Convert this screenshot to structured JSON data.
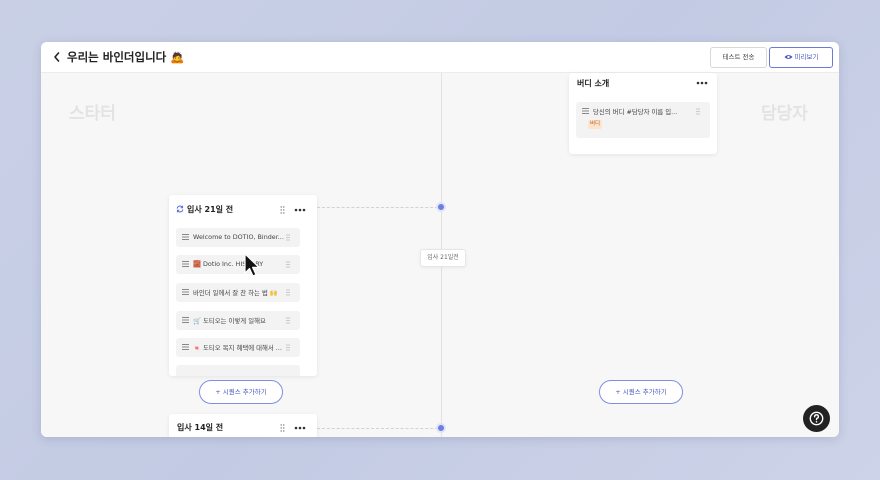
{
  "header": {
    "back_icon": "chevron-left-icon",
    "title": "우리는 바인더입니다 🙇",
    "test_send_label": "테스트 전송",
    "preview_label": "미리보기",
    "preview_icon": "eye-icon"
  },
  "lanes": {
    "left_label": "스타터",
    "right_label": "담당자"
  },
  "timeline": {
    "tooltip": "입사 21일전"
  },
  "cards": {
    "buddy": {
      "title": "버디 소개",
      "items": [
        {
          "label": "당신의 버디 #담당자 이름 입...",
          "tag": "버디"
        }
      ]
    },
    "day21": {
      "title": "입사 21일 전",
      "items": [
        {
          "label": "Welcome to DOTIO, Binder..."
        },
        {
          "label": "🧱 Dotio Inc. HISTORY"
        },
        {
          "label": "바인더 일에서 잘 찬 하는 법 🙌"
        },
        {
          "label": "🛒 도티오는 이렇게 일해요"
        },
        {
          "label": "🍬 도티오 복지 혜택에 대해서 ..."
        }
      ]
    },
    "day14": {
      "title": "입사 14일 전"
    }
  },
  "actions": {
    "add_sequence_left": "+ 시퀀스 추가하기",
    "add_sequence_right": "+ 시퀀스 추가하기"
  },
  "help_icon": "question-mark-icon",
  "colors": {
    "accent": "#6d7fe0",
    "tag_bg": "#fde4cc",
    "tag_text": "#b6642a"
  }
}
